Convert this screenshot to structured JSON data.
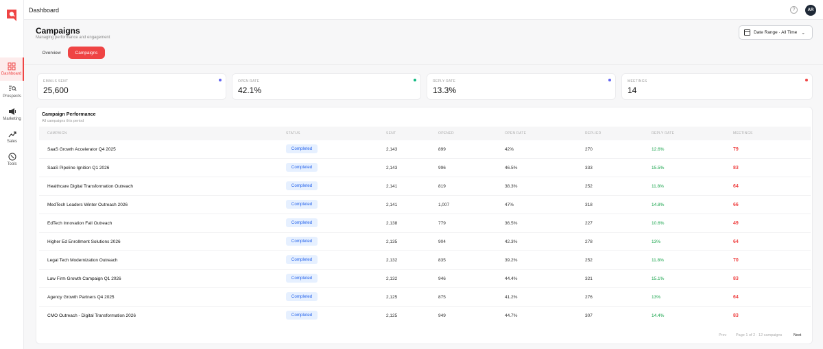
{
  "topbar": {
    "breadcrumb": "Dashboard",
    "help_icon": "?",
    "avatar_initials": "AR"
  },
  "sidebar": {
    "items": [
      {
        "label": "Dashboard",
        "icon": "grid-icon",
        "active": true
      },
      {
        "label": "Prospects",
        "icon": "search-list-icon"
      },
      {
        "label": "Marketing",
        "icon": "megaphone-icon"
      },
      {
        "label": "Sales",
        "icon": "trend-up-icon"
      },
      {
        "label": "Tools",
        "icon": "compass-icon"
      }
    ]
  },
  "header": {
    "title": "Campaigns",
    "subtitle": "Managing performance and engagement",
    "date_range_label": "Date Range · All Time"
  },
  "tabs": [
    {
      "label": "Overview"
    },
    {
      "label": "Campaigns",
      "active": true
    }
  ],
  "stats": [
    {
      "label": "EMAILS SENT",
      "value": "25,600",
      "dot_color": "#6366f1"
    },
    {
      "label": "OPEN RATE",
      "value": "42.1%",
      "dot_color": "#10b981"
    },
    {
      "label": "REPLY RATE",
      "value": "13.3%",
      "dot_color": "#6366f1"
    },
    {
      "label": "MEETINGS",
      "value": "14",
      "dot_color": "#ef4444"
    }
  ],
  "table": {
    "title": "Campaign Performance",
    "subtitle": "All campaigns this period",
    "columns": [
      "CAMPAIGN",
      "STATUS",
      "SENT",
      "OPENED",
      "OPEN RATE",
      "REPLIED",
      "REPLY RATE",
      "MEETINGS"
    ],
    "rows": [
      {
        "name": "SaaS Growth Accelerator Q4 2025",
        "status": "Completed",
        "sent": "2,143",
        "opened": "899",
        "open_rate": "42%",
        "replied": "270",
        "reply_rate": "12.6%",
        "meetings": "79"
      },
      {
        "name": "SaaS Pipeline Ignition Q1 2026",
        "status": "Completed",
        "sent": "2,143",
        "opened": "996",
        "open_rate": "46.5%",
        "replied": "333",
        "reply_rate": "15.5%",
        "meetings": "83"
      },
      {
        "name": "Healthcare Digital Transformation Outreach",
        "status": "Completed",
        "sent": "2,141",
        "opened": "819",
        "open_rate": "38.3%",
        "replied": "252",
        "reply_rate": "11.8%",
        "meetings": "64"
      },
      {
        "name": "MedTech Leaders Winter Outreach 2026",
        "status": "Completed",
        "sent": "2,141",
        "opened": "1,007",
        "open_rate": "47%",
        "replied": "318",
        "reply_rate": "14.8%",
        "meetings": "66"
      },
      {
        "name": "EdTech Innovation Fall Outreach",
        "status": "Completed",
        "sent": "2,138",
        "opened": "779",
        "open_rate": "36.5%",
        "replied": "227",
        "reply_rate": "10.6%",
        "meetings": "49"
      },
      {
        "name": "Higher Ed Enrollment Solutions 2026",
        "status": "Completed",
        "sent": "2,135",
        "opened": "904",
        "open_rate": "42.3%",
        "replied": "278",
        "reply_rate": "13%",
        "meetings": "64"
      },
      {
        "name": "Legal Tech Modernization Outreach",
        "status": "Completed",
        "sent": "2,132",
        "opened": "835",
        "open_rate": "39.2%",
        "replied": "252",
        "reply_rate": "11.8%",
        "meetings": "70"
      },
      {
        "name": "Law Firm Growth Campaign Q1 2026",
        "status": "Completed",
        "sent": "2,132",
        "opened": "946",
        "open_rate": "44.4%",
        "replied": "321",
        "reply_rate": "15.1%",
        "meetings": "83"
      },
      {
        "name": "Agency Growth Partners Q4 2025",
        "status": "Completed",
        "sent": "2,125",
        "opened": "875",
        "open_rate": "41.2%",
        "replied": "276",
        "reply_rate": "13%",
        "meetings": "64"
      },
      {
        "name": "CMO Outreach - Digital Transformation 2026",
        "status": "Completed",
        "sent": "2,125",
        "opened": "949",
        "open_rate": "44.7%",
        "replied": "307",
        "reply_rate": "14.4%",
        "meetings": "83"
      }
    ]
  },
  "pagination": {
    "prev_label": "Prev",
    "page_info": "Page 1 of 2 · 12 campaigns",
    "next_label": "Next"
  }
}
